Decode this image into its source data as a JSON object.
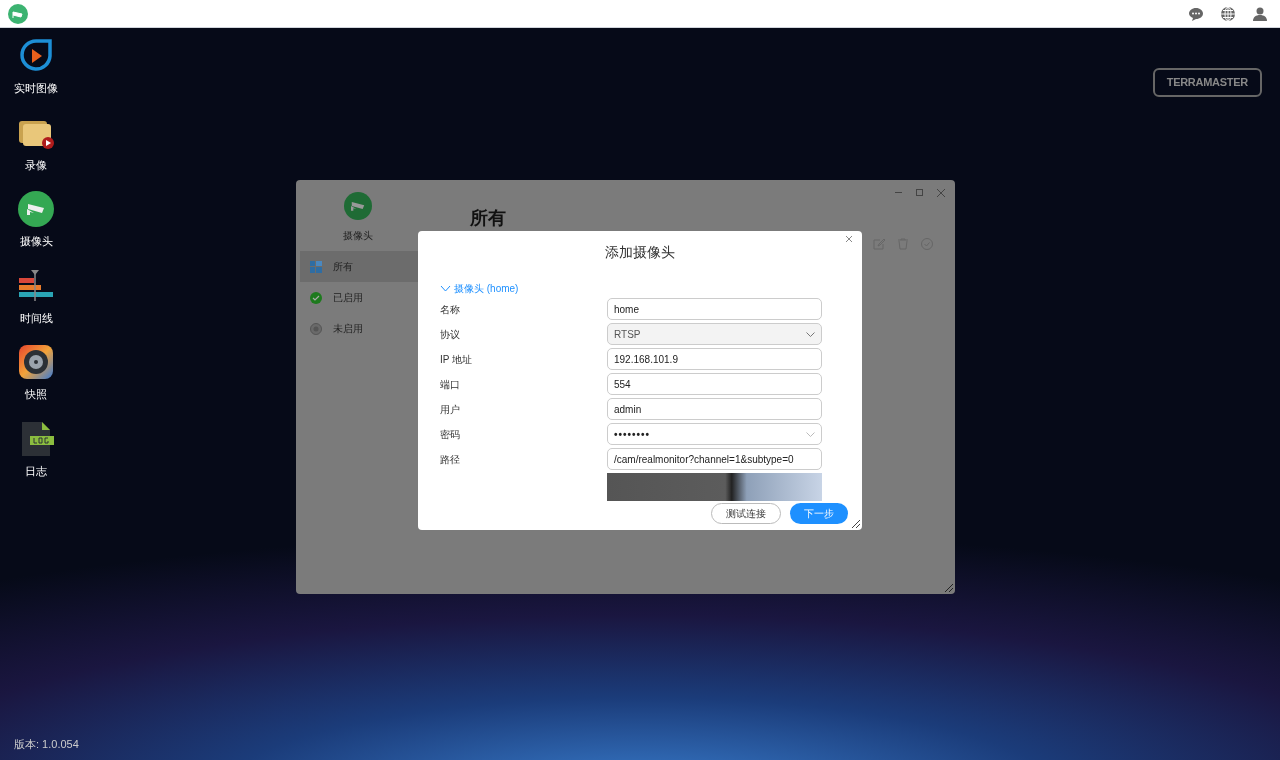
{
  "desktop_apps": [
    {
      "label": "实时图像",
      "kind": "live"
    },
    {
      "label": "录像",
      "kind": "recording"
    },
    {
      "label": "摄像头",
      "kind": "camera"
    },
    {
      "label": "时间线",
      "kind": "timeline"
    },
    {
      "label": "快照",
      "kind": "snapshot"
    },
    {
      "label": "日志",
      "kind": "log"
    }
  ],
  "brand": "TERRAMASTER",
  "version": "版本: 1.0.054",
  "window": {
    "app_name": "摄像头",
    "heading": "所有",
    "sidebar": [
      {
        "label": "所有",
        "kind": "all",
        "selected": true
      },
      {
        "label": "已启用",
        "kind": "enabled",
        "selected": false
      },
      {
        "label": "未启用",
        "kind": "disabled",
        "selected": false
      }
    ]
  },
  "dialog": {
    "title": "添加摄像头",
    "section": {
      "label": "摄像头 (home)",
      "expanded": true
    },
    "fields": [
      {
        "label": "名称",
        "value": "home",
        "kind": "text"
      },
      {
        "label": "协议",
        "value": "RTSP",
        "kind": "select"
      },
      {
        "label": "IP 地址",
        "value": "192.168.101.9",
        "kind": "text"
      },
      {
        "label": "端口",
        "value": "554",
        "kind": "text"
      },
      {
        "label": "用户",
        "value": "admin",
        "kind": "text"
      },
      {
        "label": "密码",
        "value": "••••••••",
        "kind": "password"
      },
      {
        "label": "路径",
        "value": "/cam/realmonitor?channel=1&subtype=0",
        "kind": "text"
      }
    ],
    "buttons": [
      {
        "label": "测试连接",
        "kind": "secondary"
      },
      {
        "label": "下一步",
        "kind": "primary"
      }
    ]
  }
}
